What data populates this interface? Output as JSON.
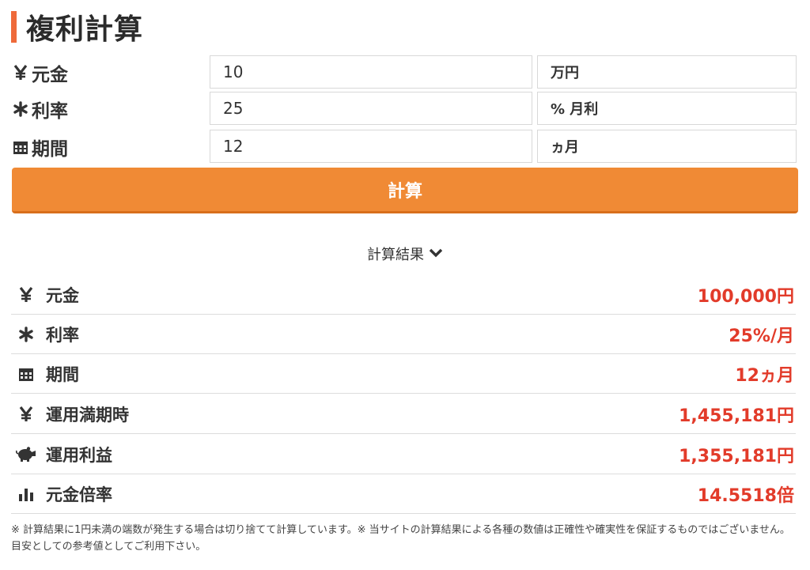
{
  "page": {
    "title": "複利計算"
  },
  "form": {
    "principal": {
      "label": "元金",
      "value": "10",
      "unit": "万円"
    },
    "rate": {
      "label": "利率",
      "value": "25",
      "unit": "% 月利"
    },
    "period": {
      "label": "期間",
      "value": "12",
      "unit": "ヵ月"
    },
    "submit_label": "計算"
  },
  "results": {
    "heading": "計算結果",
    "rows": [
      {
        "label": "元金",
        "value": "100,000円",
        "icon": "yen-icon"
      },
      {
        "label": "利率",
        "value": "25%/月",
        "icon": "asterisk-icon"
      },
      {
        "label": "期間",
        "value": "12ヵ月",
        "icon": "calendar-icon"
      },
      {
        "label": "運用満期時",
        "value": "1,455,181円",
        "icon": "yen-icon"
      },
      {
        "label": "運用利益",
        "value": "1,355,181円",
        "icon": "piggy-bank-icon"
      },
      {
        "label": "元金倍率",
        "value": "14.5518倍",
        "icon": "bar-chart-icon"
      }
    ]
  },
  "note": "※ 計算結果に1円未満の端数が発生する場合は切り捨てて計算しています。※ 当サイトの計算結果による各種の数値は正確性や確実性を保証するものではございません。目安としての参考値としてご利用下さい。",
  "colors": {
    "accent": "#ef6a3a",
    "button": "#f08a35",
    "value": "#e23b2a"
  }
}
